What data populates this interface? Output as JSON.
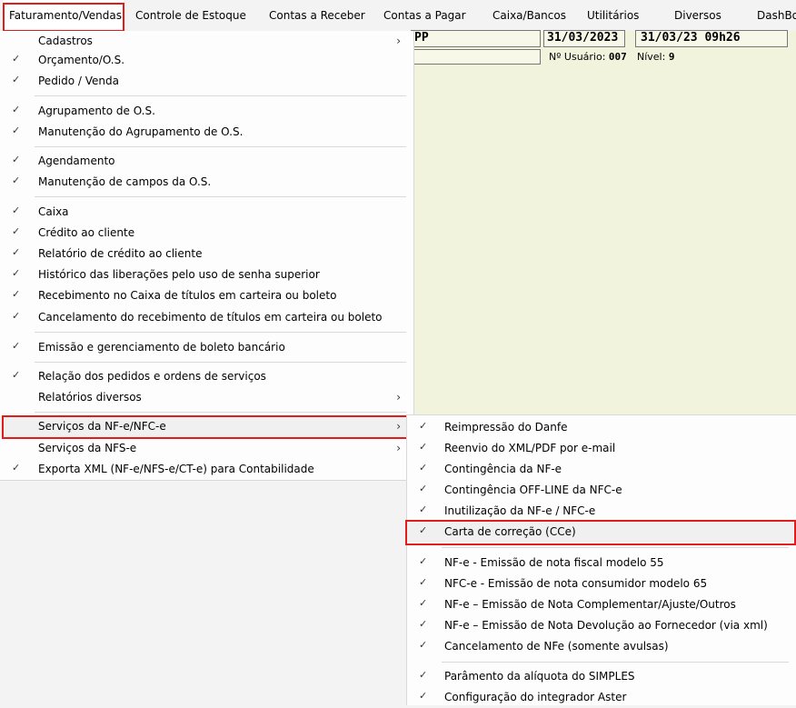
{
  "menubar": {
    "items": [
      {
        "label": "Faturamento/Vendas"
      },
      {
        "label": "Controle de Estoque"
      },
      {
        "label": "Contas a Receber"
      },
      {
        "label": "Contas a Pagar"
      },
      {
        "label": "Caixa/Bancos"
      },
      {
        "label": "Utilitários"
      },
      {
        "label": "Diversos"
      },
      {
        "label": "DashBo"
      }
    ]
  },
  "status": {
    "field1": "PP",
    "date": "31/03/2023",
    "datetime": "31/03/23 09h26",
    "user_label": "Nº Usuário:",
    "user_value": "007",
    "level_label": "Nível:",
    "level_value": "9"
  },
  "glyphs": {
    "check": "✓",
    "arrow": "›"
  },
  "menu": {
    "items": [
      {
        "label": "Cadastros"
      },
      {
        "label": "Orçamento/O.S."
      },
      {
        "label": "Pedido / Venda"
      },
      {
        "label": "Agrupamento de O.S."
      },
      {
        "label": "Manutenção do Agrupamento de O.S."
      },
      {
        "label": "Agendamento"
      },
      {
        "label": "Manutenção de campos da O.S."
      },
      {
        "label": "Caixa"
      },
      {
        "label": "Crédito ao cliente"
      },
      {
        "label": "Relatório de crédito ao cliente"
      },
      {
        "label": "Histórico das liberações pelo uso de senha superior"
      },
      {
        "label": "Recebimento no Caixa de títulos em carteira ou boleto"
      },
      {
        "label": "Cancelamento do recebimento de títulos em carteira ou boleto"
      },
      {
        "label": "Emissão e gerenciamento de boleto bancário"
      },
      {
        "label": "Relação dos pedidos e ordens de serviços"
      },
      {
        "label": "Relatórios diversos"
      },
      {
        "label": "Serviços da NF-e/NFC-e"
      },
      {
        "label": "Serviços da NFS-e"
      },
      {
        "label": "Exporta XML (NF-e/NFS-e/CT-e) para Contabilidade"
      }
    ]
  },
  "submenu": {
    "items": [
      {
        "label": "Reimpressão do Danfe"
      },
      {
        "label": "Reenvio do XML/PDF por e-mail"
      },
      {
        "label": "Contingência da NF-e"
      },
      {
        "label": "Contingência OFF-LINE da NFC-e"
      },
      {
        "label": "Inutilização da NF-e / NFC-e"
      },
      {
        "label": "Carta de correção (CCe)"
      },
      {
        "label": "NF-e - Emissão de nota fiscal modelo 55"
      },
      {
        "label": "NFC-e - Emissão de nota consumidor modelo 65"
      },
      {
        "label": "NF-e – Emissão de Nota Complementar/Ajuste/Outros"
      },
      {
        "label": "NF-e – Emissão de Nota Devolução ao Fornecedor (via xml)"
      },
      {
        "label": "Cancelamento de NFe (somente avulsas)"
      },
      {
        "label": "Parâmento da alíquota do SIMPLES"
      },
      {
        "label": "Configuração do integrador Aster"
      }
    ]
  }
}
